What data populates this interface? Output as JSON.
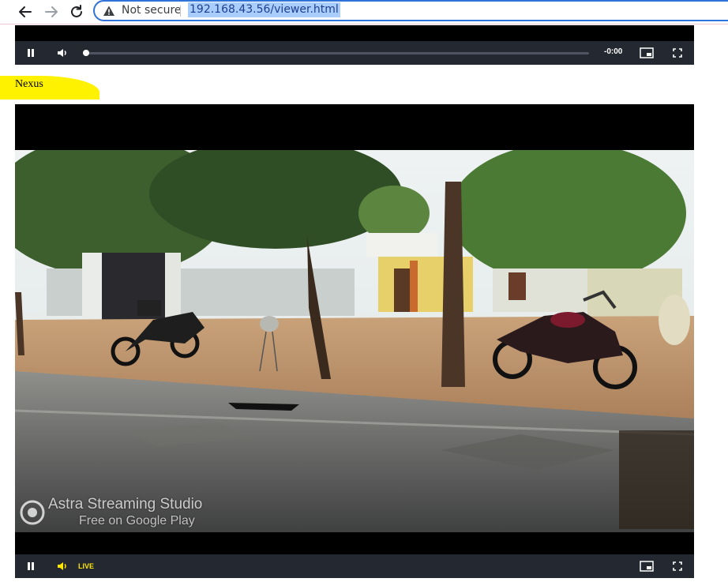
{
  "browser": {
    "security_label": "Not secure",
    "url": "192.168.43.56/viewer.html"
  },
  "top_player": {
    "time": "-0:00",
    "progress": 0
  },
  "stream_label": "Nexus",
  "main_player": {
    "live_label": "LIVE",
    "watermark_title": "Astra Streaming Studio",
    "watermark_subtitle": "Free on Google Play"
  },
  "colors": {
    "omnibox_border": "#2f73d9",
    "highlight": "#fff200",
    "live_text": "#ffe600",
    "controlbar": "#232831"
  }
}
